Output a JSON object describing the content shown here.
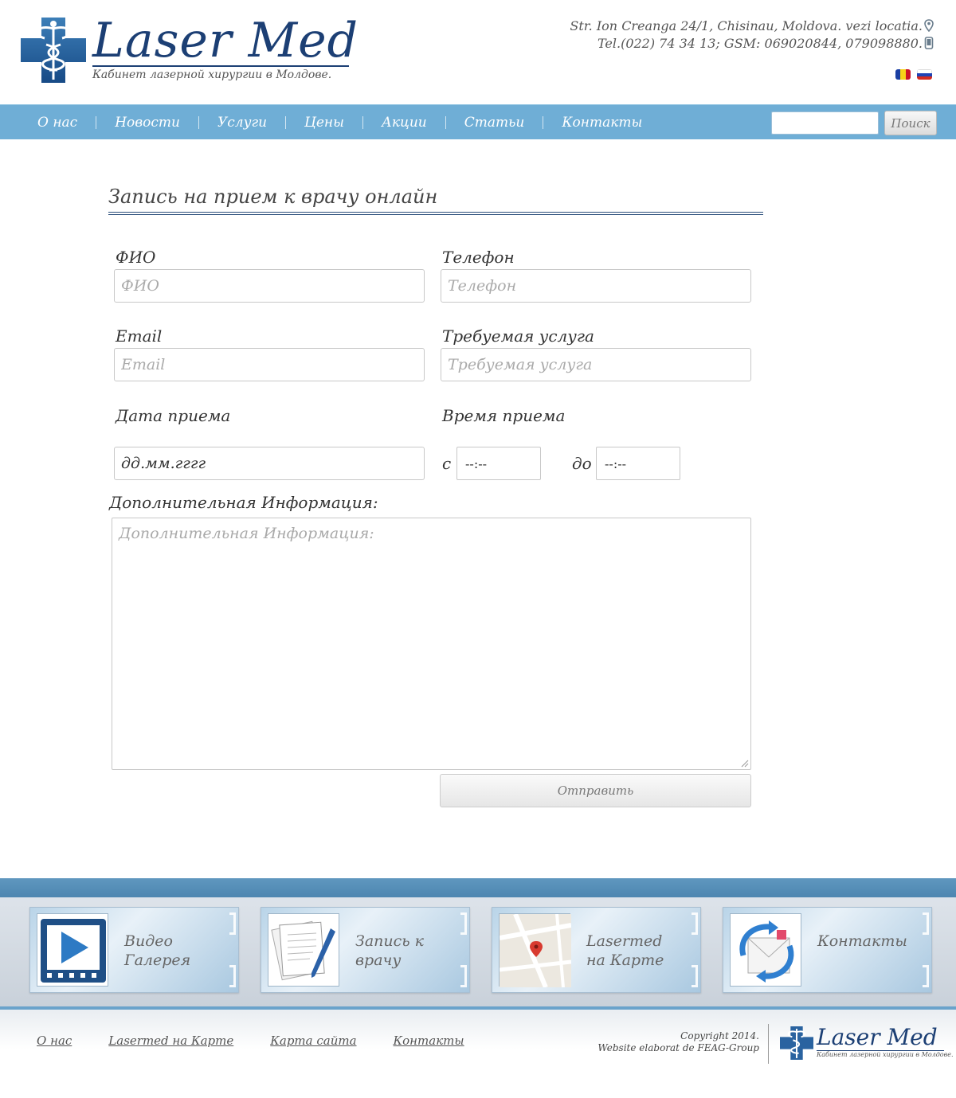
{
  "header": {
    "logo_title": "Laser Med",
    "logo_subtitle": "Кабинет лазерной хирургии в Молдове.",
    "address": "Str. Ion Creanga 24/1, Chisinau, Moldova. vezi locatia.",
    "phone": "Tel.(022) 74 34 13; GSM: 069020844, 079098880.",
    "languages": [
      "ro",
      "ru"
    ]
  },
  "nav": {
    "items": [
      "О нас",
      "Новости",
      "Услуги",
      "Цены",
      "Акции",
      "Статьи",
      "Контакты"
    ],
    "search_placeholder": "",
    "search_button": "Поиск"
  },
  "form": {
    "title": "Запись на прием к врачу онлайн",
    "name_label": "ФИО",
    "name_placeholder": "ФИО",
    "phone_label": "Телефон",
    "phone_placeholder": "Телефон",
    "email_label": "Email",
    "email_placeholder": "Email",
    "service_label": "Требуемая услуга",
    "service_placeholder": "Требуемая услуга",
    "date_label": "Дата приема",
    "date_value": "дд.мм.гггг",
    "time_label": "Время приема",
    "time_from_label": "с",
    "time_from_value": "--:--",
    "time_to_label": "до",
    "time_to_value": "--:--",
    "info_label": "Дополнительная Информация:",
    "info_placeholder": "Дополнительная Информация:",
    "submit_label": "Отправить"
  },
  "tiles": [
    {
      "line1": "Видео",
      "line2": "Галерея"
    },
    {
      "line1": "Запись к",
      "line2": "врачу"
    },
    {
      "line1": "Lasermed",
      "line2": "на Карте"
    },
    {
      "line1": "Контакты",
      "line2": ""
    }
  ],
  "footer": {
    "links": [
      "О нас",
      "Lasermed на Карте",
      "Карта сайта",
      "Контакты"
    ],
    "copyright_line1": "Copyright 2014.",
    "copyright_line2": "Website elaborat de FEAG-Group",
    "logo_title": "Laser Med",
    "logo_subtitle": "Кабинет лазерной хирургии в Молдове."
  },
  "colors": {
    "brand": "#1c3f74",
    "nav": "#6faed6",
    "band": "#5f97bf"
  }
}
